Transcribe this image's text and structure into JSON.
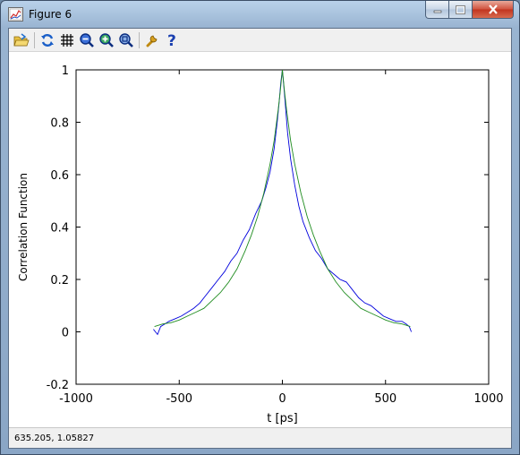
{
  "window": {
    "title": "Figure 6"
  },
  "toolbar": {
    "icons": [
      "open-folder-icon",
      "refresh-icon",
      "grid-icon",
      "zoom-out-icon",
      "zoom-in-icon",
      "zoom-reset-icon",
      "wrench-icon",
      "help-icon"
    ]
  },
  "status": {
    "coordinates": "635.205,  1.05827"
  },
  "colors": {
    "series_data": "#0000dd",
    "series_fit": "#1f8c1f"
  },
  "chart_data": {
    "type": "line",
    "title": "",
    "xlabel": "t [ps]",
    "ylabel": "Correlation Function",
    "xlim": [
      -1000,
      1000
    ],
    "ylim": [
      -0.2,
      1
    ],
    "xticks": [
      -1000,
      -500,
      0,
      500,
      1000
    ],
    "yticks": [
      -0.2,
      0,
      0.2,
      0.4,
      0.6,
      0.8,
      1
    ],
    "xtick_labels": [
      "-1000",
      "-500",
      "0",
      "500",
      "1000"
    ],
    "ytick_labels": [
      "-0.2",
      "0",
      "0.2",
      "0.4",
      "0.6",
      "0.8",
      "1"
    ],
    "grid": false,
    "legend": "none",
    "series": [
      {
        "color": "#0000dd",
        "x": [
          -625,
          -605,
          -590,
          -570,
          -550,
          -520,
          -490,
          -460,
          -430,
          -400,
          -370,
          -340,
          -310,
          -280,
          -250,
          -220,
          -190,
          -160,
          -130,
          -100,
          -80,
          -60,
          -40,
          -25,
          -15,
          -8,
          0,
          8,
          15,
          25,
          40,
          60,
          80,
          100,
          130,
          160,
          190,
          220,
          250,
          280,
          310,
          340,
          370,
          400,
          430,
          460,
          490,
          520,
          550,
          580,
          600,
          615,
          625
        ],
        "y": [
          0.01,
          -0.01,
          0.02,
          0.03,
          0.04,
          0.05,
          0.06,
          0.075,
          0.09,
          0.11,
          0.14,
          0.17,
          0.2,
          0.23,
          0.27,
          0.3,
          0.35,
          0.39,
          0.45,
          0.5,
          0.55,
          0.61,
          0.7,
          0.8,
          0.88,
          0.95,
          1.0,
          0.93,
          0.86,
          0.76,
          0.66,
          0.56,
          0.48,
          0.42,
          0.36,
          0.31,
          0.28,
          0.24,
          0.22,
          0.2,
          0.19,
          0.16,
          0.13,
          0.11,
          0.1,
          0.08,
          0.06,
          0.05,
          0.04,
          0.04,
          0.03,
          0.02,
          0.0
        ]
      },
      {
        "color": "#1f8c1f",
        "x": [
          -620,
          -580,
          -540,
          -500,
          -460,
          -420,
          -380,
          -340,
          -300,
          -260,
          -220,
          -180,
          -150,
          -120,
          -90,
          -60,
          -40,
          -20,
          -10,
          0,
          10,
          20,
          40,
          60,
          90,
          120,
          150,
          180,
          220,
          260,
          300,
          340,
          380,
          420,
          460,
          500,
          540,
          580,
          620
        ],
        "y": [
          0.02,
          0.03,
          0.035,
          0.045,
          0.06,
          0.075,
          0.09,
          0.12,
          0.15,
          0.19,
          0.24,
          0.31,
          0.37,
          0.44,
          0.53,
          0.64,
          0.73,
          0.85,
          0.92,
          1.0,
          0.92,
          0.85,
          0.73,
          0.64,
          0.53,
          0.44,
          0.37,
          0.31,
          0.24,
          0.19,
          0.15,
          0.12,
          0.09,
          0.075,
          0.06,
          0.045,
          0.035,
          0.03,
          0.02
        ]
      }
    ]
  }
}
